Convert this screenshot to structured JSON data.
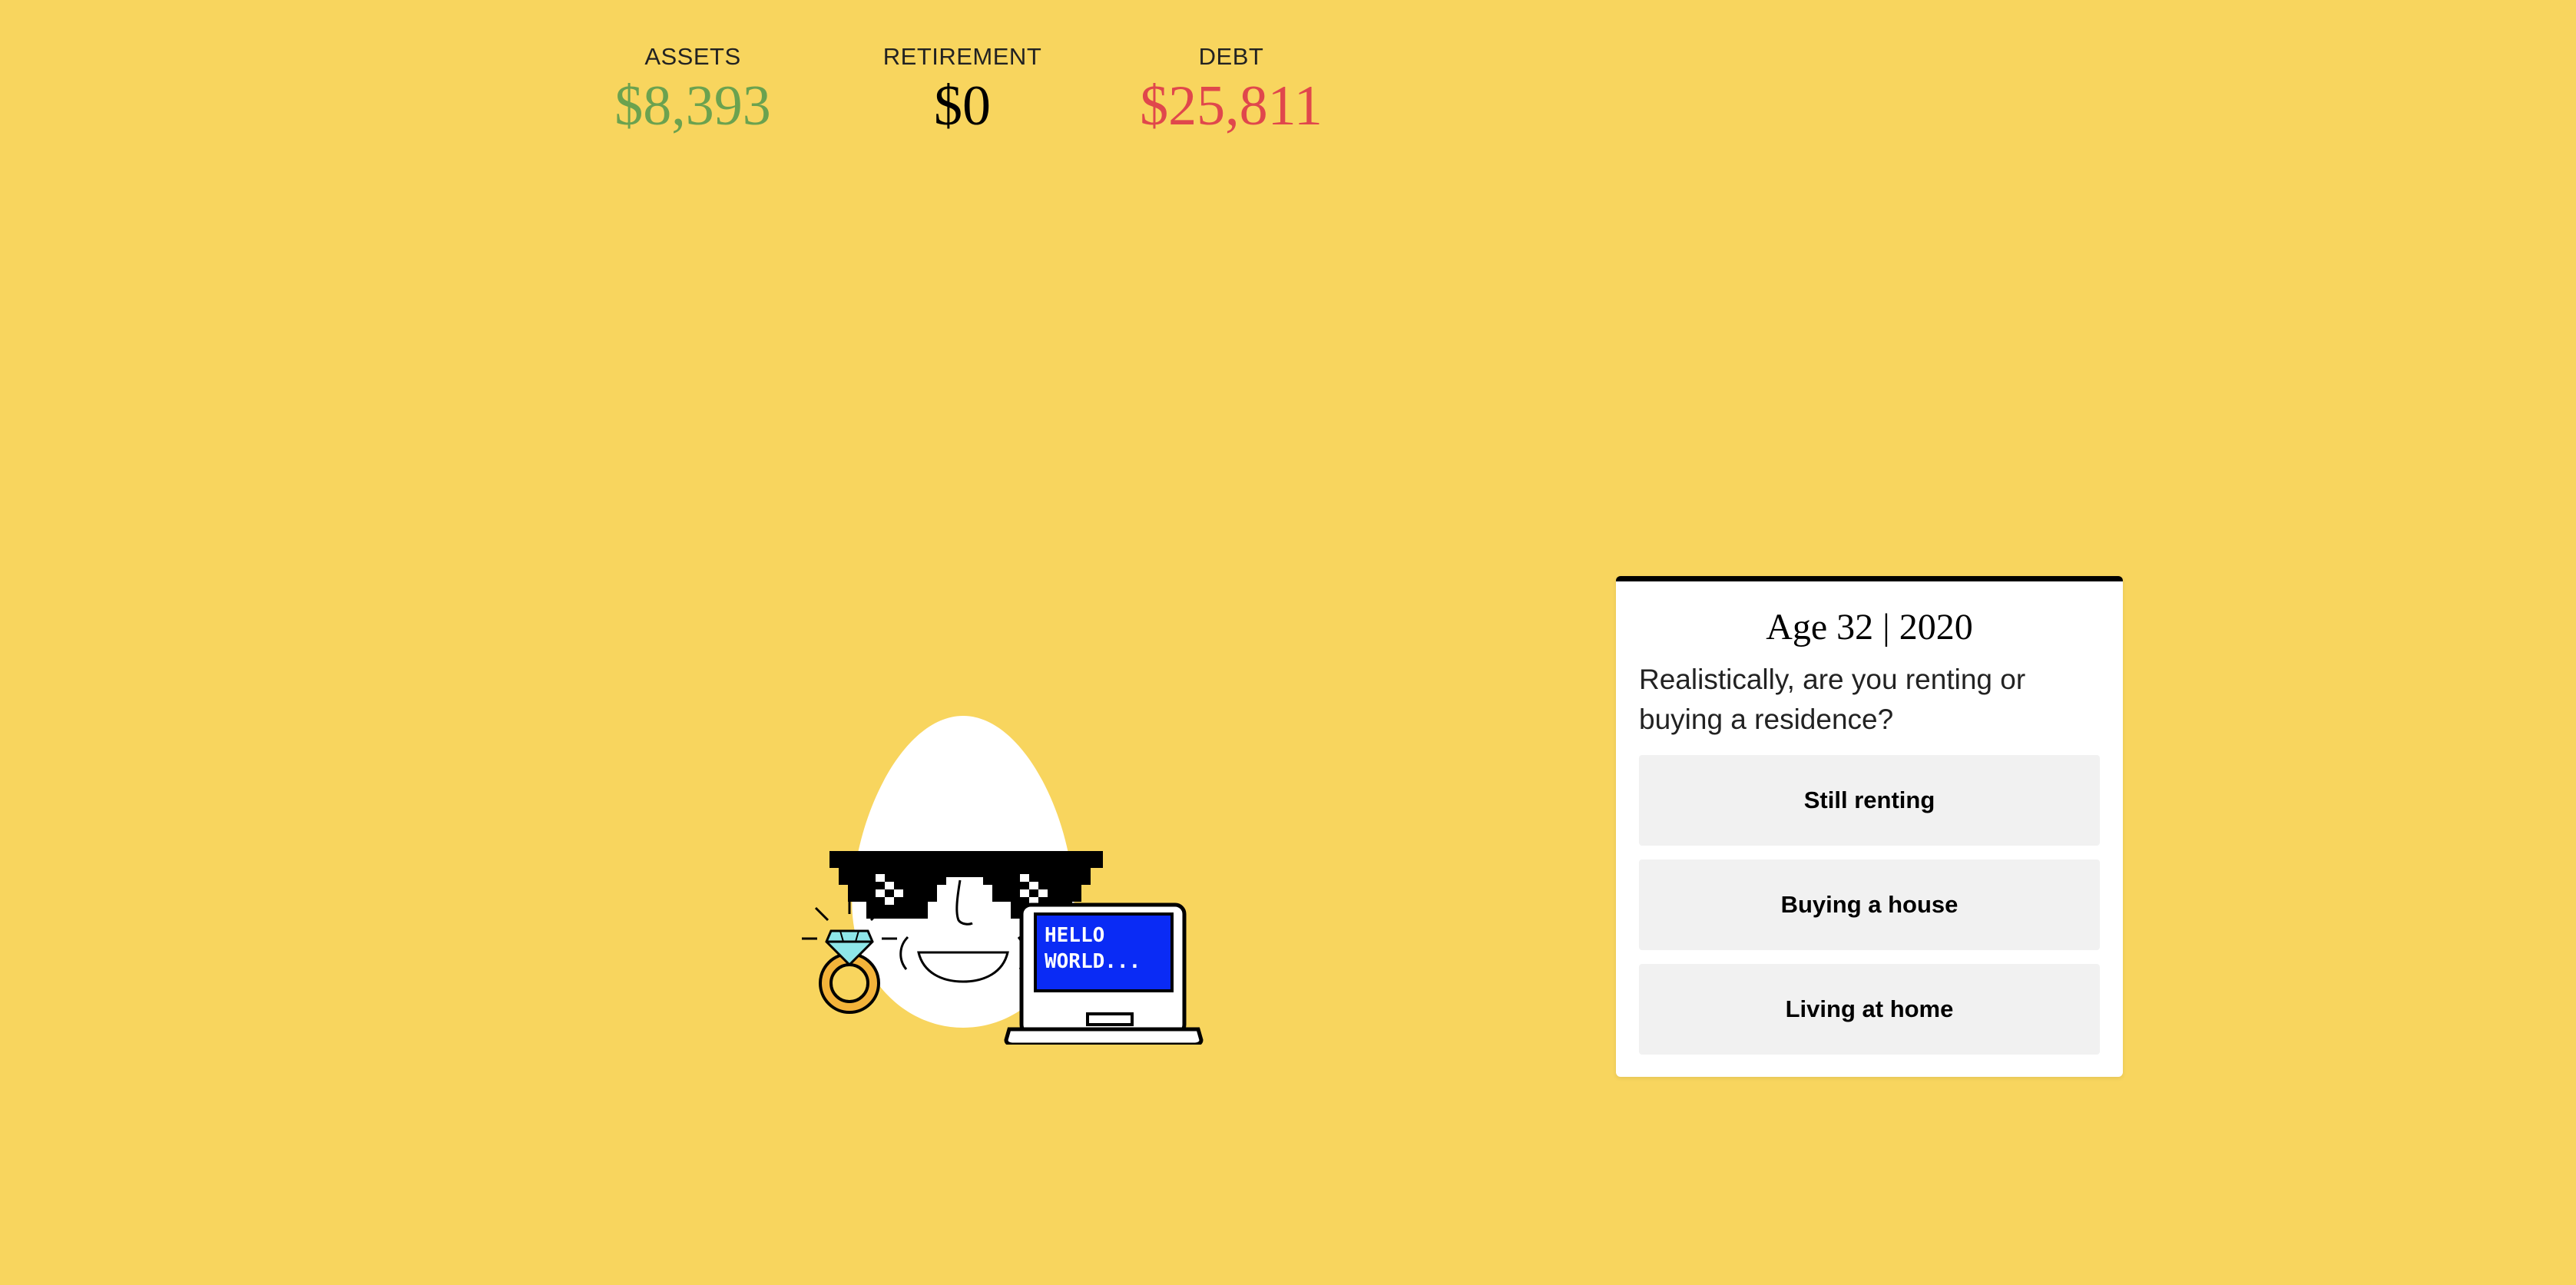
{
  "stats": {
    "assets": {
      "label": "ASSETS",
      "value": "$8,393",
      "color": "#6BA24F"
    },
    "retirement": {
      "label": "RETIREMENT",
      "value": "$0",
      "color": "#000000"
    },
    "debt": {
      "label": "DEBT",
      "value": "$25,811",
      "color": "#E0474C"
    }
  },
  "illustration": {
    "laptop_screen_text_line1": "HELLO",
    "laptop_screen_text_line2": "WORLD...",
    "icons": [
      "egg-character",
      "pixel-sunglasses-icon",
      "diamond-ring-icon",
      "laptop-icon"
    ]
  },
  "card": {
    "title": "Age 32 | 2020",
    "question": "Realistically, are you renting or buying a residence?",
    "options": [
      {
        "label": "Still renting"
      },
      {
        "label": "Buying a house"
      },
      {
        "label": "Living at home"
      }
    ]
  },
  "colors": {
    "background": "#F8D55E",
    "card_background": "#FFFFFF",
    "option_background": "#F1F1F1",
    "laptop_screen": "#0A2BF5"
  }
}
